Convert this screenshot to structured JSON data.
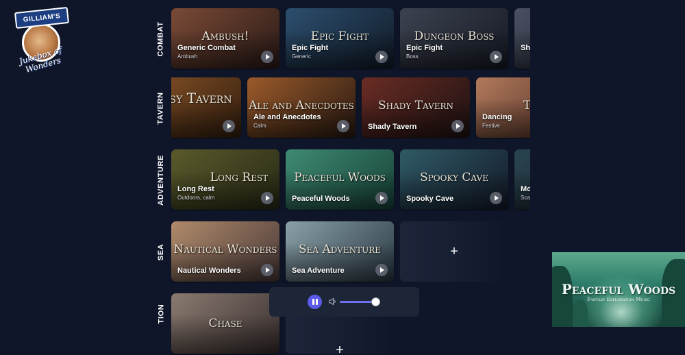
{
  "logo": {
    "banner": "GILLIAM'S",
    "script": "Jukebox of Wonders"
  },
  "rows": [
    {
      "label": "COMBAT",
      "cards": [
        {
          "art": "Ambush!",
          "name": "Generic Combat",
          "sub": "Ambush",
          "colors": [
            "#7a4a36",
            "#2c1b17"
          ]
        },
        {
          "art": "Epic Fight",
          "name": "Epic Fight",
          "sub": "Generic",
          "colors": [
            "#2c4f6e",
            "#121c2a"
          ]
        },
        {
          "art": "Dungeon Boss",
          "name": "Epic Fight",
          "sub": "Boss",
          "colors": [
            "#3c4250",
            "#161a24"
          ]
        },
        {
          "art": "",
          "name": "Shi",
          "sub": "",
          "colors": [
            "#4a5060",
            "#1d2230"
          ]
        }
      ]
    },
    {
      "label": "TAVERN",
      "cards": [
        {
          "art": "asy Tavern",
          "name": "",
          "sub": "",
          "colors": [
            "#8a5428",
            "#35200f"
          ]
        },
        {
          "art": "Ale and Anecdotes",
          "name": "Ale and Anecdotes",
          "sub": "Calm",
          "colors": [
            "#9a5a2a",
            "#2a1a12"
          ]
        },
        {
          "art": "Shady Tavern",
          "name": "Shady Tavern",
          "sub": "",
          "colors": [
            "#6a2c24",
            "#1e1212"
          ]
        },
        {
          "art": "Tavern",
          "name": "Dancing",
          "sub": "Festive",
          "colors": [
            "#b27a5c",
            "#4a2a22"
          ]
        }
      ]
    },
    {
      "label": "ADVENTURE",
      "cards": [
        {
          "art": "Long Rest",
          "name": "Long Rest",
          "sub": "Outdoors, calm",
          "colors": [
            "#5a5a2c",
            "#2a2a16"
          ]
        },
        {
          "art": "Peaceful Woods",
          "name": "Peaceful Woods",
          "sub": "",
          "colors": [
            "#3f8a72",
            "#17433a"
          ]
        },
        {
          "art": "Spooky Cave",
          "name": "Spooky Cave",
          "sub": "",
          "colors": [
            "#2f5a66",
            "#141a2a"
          ]
        },
        {
          "art": "",
          "name": "Mo",
          "sub": "Scar",
          "colors": [
            "#2a4550",
            "#151d28"
          ]
        }
      ]
    },
    {
      "label": "SEA",
      "cards": [
        {
          "art": "Nautical Wonders",
          "name": "Nautical Wonders",
          "sub": "",
          "colors": [
            "#b08a6a",
            "#4a3a3a"
          ]
        },
        {
          "art": "Sea Adventure",
          "name": "Sea Adventure",
          "sub": "",
          "colors": [
            "#8aa0a8",
            "#2a3a44"
          ]
        }
      ],
      "add_label": "+"
    },
    {
      "label": "TION",
      "cards": [
        {
          "art": "Chase",
          "name": "",
          "sub": "",
          "colors": [
            "#8a7a70",
            "#3a3030"
          ]
        }
      ],
      "add_label": "+"
    }
  ],
  "player": {
    "volume_level": 0.92
  },
  "now_playing": {
    "title": "Peaceful Woods",
    "subtitle": "Fantasy Exploration Music"
  },
  "colors": {
    "background": "#0f1629",
    "accent": "#5b5be8",
    "panel": "#1d2637"
  },
  "icons": {
    "play": "play-icon",
    "pause": "pause-icon",
    "volume": "volume-icon",
    "add": "plus-icon"
  }
}
